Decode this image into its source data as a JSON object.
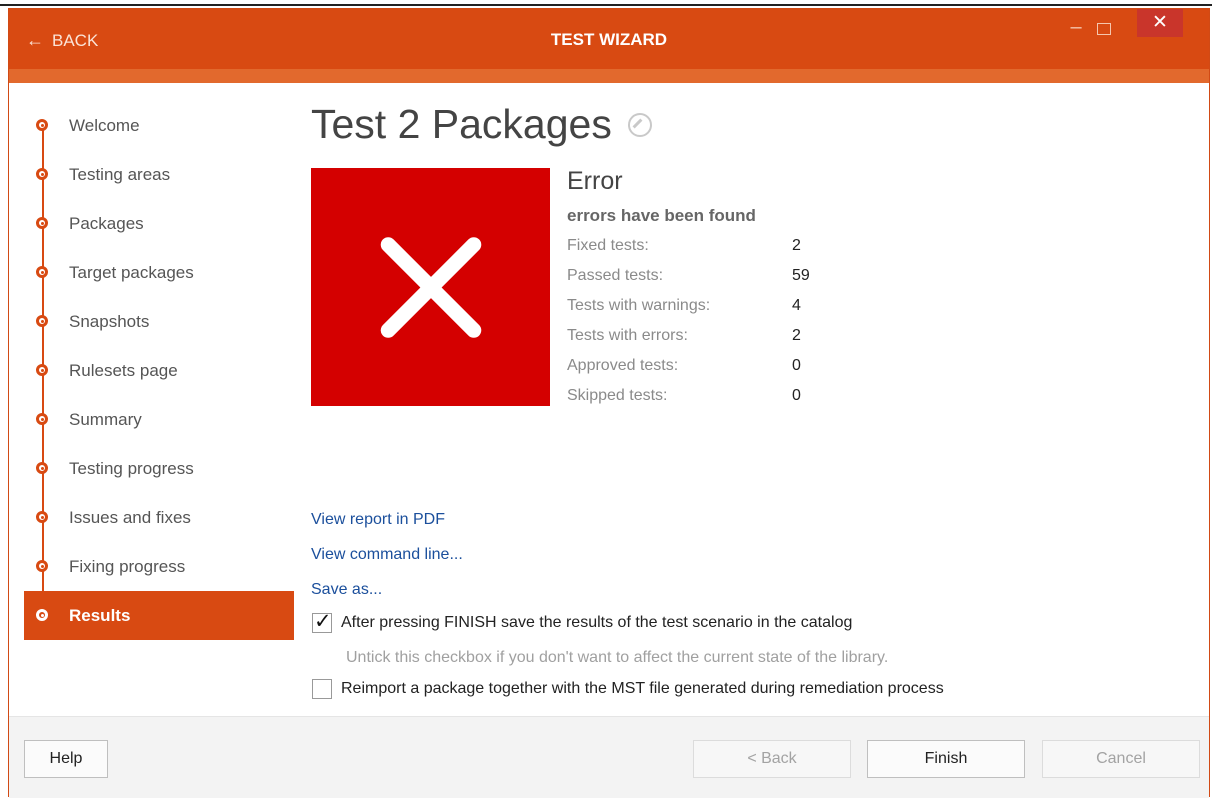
{
  "titlebar": {
    "back_label": "BACK",
    "title": "TEST WIZARD",
    "minimize": "–",
    "close": "✕"
  },
  "sidebar": {
    "items": [
      {
        "label": "Welcome"
      },
      {
        "label": "Testing areas"
      },
      {
        "label": "Packages"
      },
      {
        "label": "Target packages"
      },
      {
        "label": "Snapshots"
      },
      {
        "label": "Rulesets page"
      },
      {
        "label": "Summary"
      },
      {
        "label": "Testing progress"
      },
      {
        "label": "Issues and fixes"
      },
      {
        "label": "Fixing progress"
      },
      {
        "label": "Results"
      }
    ],
    "active_index": 10
  },
  "main": {
    "title": "Test 2 Packages",
    "status_title": "Error",
    "status_sub": "errors have been found",
    "stats": [
      {
        "label": "Fixed tests:",
        "value": "2"
      },
      {
        "label": "Passed tests:",
        "value": "59"
      },
      {
        "label": "Tests with warnings:",
        "value": "4"
      },
      {
        "label": "Tests with errors:",
        "value": "2"
      },
      {
        "label": "Approved tests:",
        "value": "0"
      },
      {
        "label": "Skipped tests:",
        "value": "0"
      }
    ],
    "links": {
      "pdf": "View report in PDF",
      "cmd": "View command line...",
      "save": "Save as..."
    },
    "save_results_checkbox": {
      "label": "After pressing FINISH save the results of the test scenario in the catalog",
      "checked": true,
      "hint": "Untick this checkbox if you don't want to affect the current state of the library."
    },
    "reimport_checkbox": {
      "label": "Reimport a package together with the MST file generated during remediation process",
      "checked": false
    }
  },
  "footer": {
    "help": "Help",
    "back": "< Back",
    "finish": "Finish",
    "cancel": "Cancel"
  },
  "colors": {
    "accent": "#d84a12",
    "error_tile": "#d40000",
    "link": "#1b4f9c"
  }
}
